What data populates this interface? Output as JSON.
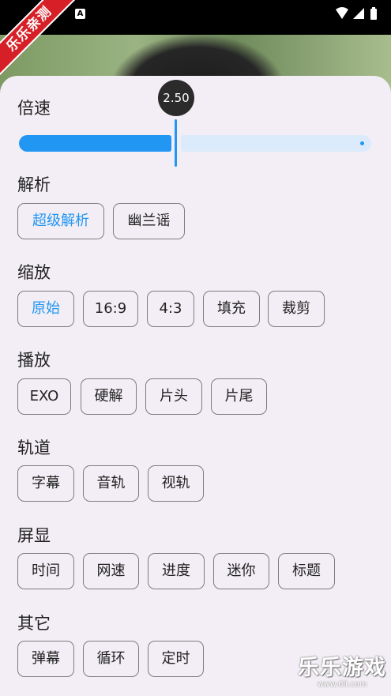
{
  "status_bar": {
    "badge": "A",
    "icons": [
      "wifi-icon",
      "signal-icon",
      "battery-icon"
    ]
  },
  "ribbon": "乐乐亲测",
  "speed": {
    "title": "倍速",
    "value_label": "2.50",
    "fraction": 0.44
  },
  "sections": {
    "parse": {
      "title": "解析",
      "options": [
        "超级解析",
        "幽兰谣"
      ]
    },
    "zoom": {
      "title": "缩放",
      "options": [
        "原始",
        "16:9",
        "4:3",
        "填充",
        "裁剪"
      ]
    },
    "player": {
      "title": "播放",
      "options": [
        "EXO",
        "硬解",
        "片头",
        "片尾"
      ]
    },
    "track": {
      "title": "轨道",
      "options": [
        "字幕",
        "音轨",
        "视轨"
      ]
    },
    "display": {
      "title": "屏显",
      "options": [
        "时间",
        "网速",
        "进度",
        "迷你",
        "标题"
      ]
    },
    "other": {
      "title": "其它",
      "options": [
        "弹幕",
        "循环",
        "定时"
      ]
    }
  },
  "watermark": {
    "title": "乐乐游戏",
    "url": "www.6ll.com"
  },
  "colors": {
    "accent": "#2196f3",
    "sheet_bg": "#f3eef5",
    "chip_border": "#7c7c80"
  }
}
